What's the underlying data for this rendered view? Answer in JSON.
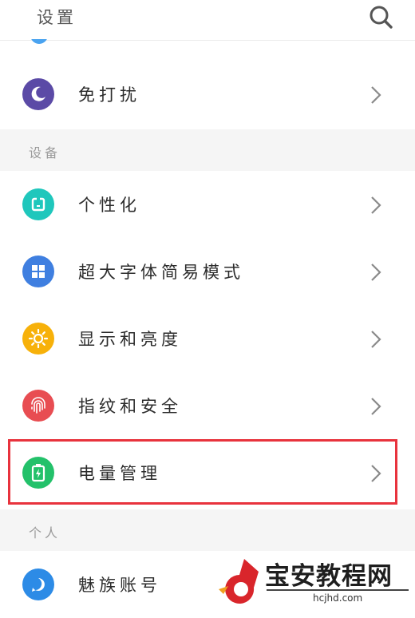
{
  "header": {
    "title": "设置",
    "search_icon": "search-icon"
  },
  "rows_top": [
    {
      "id": "dnd",
      "label": "免打扰",
      "icon": "moon-icon",
      "color": "#5b4aa6"
    }
  ],
  "sections": [
    {
      "title": "设备",
      "items": [
        {
          "id": "personalize",
          "label": "个性化",
          "icon": "phone-theme-icon",
          "color": "#1fc7bc"
        },
        {
          "id": "large-font",
          "label": "超大字体简易模式",
          "icon": "grid-icon",
          "color": "#3f7fe0"
        },
        {
          "id": "display",
          "label": "显示和亮度",
          "icon": "sun-icon",
          "color": "#f7b10a"
        },
        {
          "id": "fingerprint",
          "label": "指纹和安全",
          "icon": "fingerprint-icon",
          "color": "#e84d52"
        },
        {
          "id": "battery",
          "label": "电量管理",
          "icon": "battery-icon",
          "color": "#23c16a"
        }
      ]
    },
    {
      "title": "个人",
      "items": [
        {
          "id": "account",
          "label": "魅族账号",
          "icon": "account-icon",
          "color": "#2d8be6"
        }
      ]
    }
  ],
  "watermark": {
    "title": "宝安教程网",
    "url": "hcjhd.com",
    "logo_color": "#d9252b",
    "accent": "#f0a020"
  },
  "highlight_color": "#e8333d"
}
